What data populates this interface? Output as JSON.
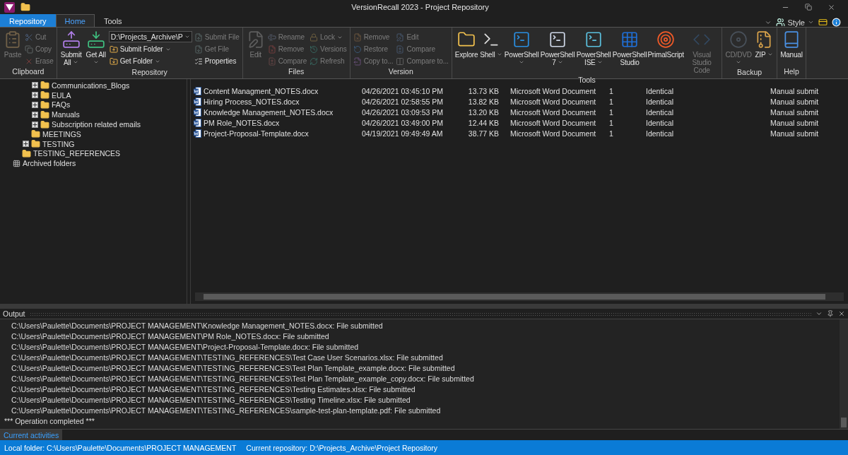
{
  "window": {
    "title": "VersionRecall 2023 - Project Repository"
  },
  "ribbon_tabs": [
    {
      "label": "Repository",
      "kind": "file",
      "selected": false
    },
    {
      "label": "Home",
      "kind": "tab",
      "selected": true
    },
    {
      "label": "Tools",
      "kind": "tab",
      "selected": false
    }
  ],
  "style_menu": {
    "label": "Style"
  },
  "ribbon_groups": [
    {
      "label": "Clipboard",
      "buttons": [
        {
          "kind": "large",
          "label": "Paste",
          "disabled": true,
          "dropdown": false
        },
        {
          "kind": "small",
          "label": "Cut",
          "disabled": true,
          "dropdown": false
        },
        {
          "kind": "small",
          "label": "Copy",
          "disabled": true,
          "dropdown": false
        },
        {
          "kind": "small",
          "label": "Erase",
          "disabled": true,
          "dropdown": false
        }
      ]
    },
    {
      "label": "Repository",
      "buttons": [
        {
          "kind": "large",
          "label": "Submit All",
          "disabled": false,
          "dropdown": true
        },
        {
          "kind": "large",
          "label": "Get All",
          "disabled": false,
          "dropdown": true
        },
        {
          "kind": "combo",
          "label": "D:\\Projects_Archive\\P",
          "disabled": false,
          "dropdown": true
        },
        {
          "kind": "small",
          "label": "Submit Folder",
          "disabled": false,
          "dropdown": true
        },
        {
          "kind": "small",
          "label": "Get Folder",
          "disabled": false,
          "dropdown": true
        },
        {
          "kind": "small",
          "label": "Submit File",
          "disabled": true,
          "dropdown": false
        },
        {
          "kind": "small",
          "label": "Get File",
          "disabled": true,
          "dropdown": false
        },
        {
          "kind": "small",
          "label": "Properties",
          "disabled": false,
          "dropdown": false
        }
      ]
    },
    {
      "label": "Files",
      "buttons": [
        {
          "kind": "large",
          "label": "Edit",
          "disabled": true,
          "dropdown": false
        },
        {
          "kind": "small",
          "label": "Rename",
          "disabled": true,
          "dropdown": false
        },
        {
          "kind": "small",
          "label": "Remove",
          "disabled": true,
          "dropdown": false
        },
        {
          "kind": "small",
          "label": "Compare",
          "disabled": true,
          "dropdown": false
        },
        {
          "kind": "small",
          "label": "Lock",
          "disabled": true,
          "dropdown": true
        },
        {
          "kind": "small",
          "label": "Versions",
          "disabled": true,
          "dropdown": false
        },
        {
          "kind": "small",
          "label": "Refresh",
          "disabled": true,
          "dropdown": false
        }
      ]
    },
    {
      "label": "Version",
      "buttons": [
        {
          "kind": "small",
          "label": "Remove",
          "disabled": true,
          "dropdown": false
        },
        {
          "kind": "small",
          "label": "Restore",
          "disabled": true,
          "dropdown": false
        },
        {
          "kind": "small",
          "label": "Copy to...",
          "disabled": true,
          "dropdown": false
        },
        {
          "kind": "small",
          "label": "Edit",
          "disabled": true,
          "dropdown": false
        },
        {
          "kind": "small",
          "label": "Compare",
          "disabled": true,
          "dropdown": false
        },
        {
          "kind": "small",
          "label": "Compare to...",
          "disabled": true,
          "dropdown": false
        }
      ]
    },
    {
      "label": "Tools",
      "buttons": [
        {
          "kind": "large",
          "label": "Explore",
          "disabled": false,
          "dropdown": false
        },
        {
          "kind": "large",
          "label": "Shell",
          "disabled": false,
          "dropdown": true
        },
        {
          "kind": "large",
          "label": "PowerShell",
          "disabled": false,
          "dropdown": true
        },
        {
          "kind": "large",
          "label": "PowerShell 7",
          "disabled": false,
          "dropdown": true
        },
        {
          "kind": "large",
          "label": "PowerShell ISE",
          "disabled": false,
          "dropdown": true
        },
        {
          "kind": "large",
          "label": "PowerShell Studio",
          "disabled": false,
          "dropdown": false
        },
        {
          "kind": "large",
          "label": "PrimalScript",
          "disabled": false,
          "dropdown": false
        },
        {
          "kind": "large",
          "label": "Visual Studio Code",
          "disabled": true,
          "dropdown": false
        }
      ]
    },
    {
      "label": "Backup",
      "buttons": [
        {
          "kind": "large",
          "label": "CD/DVD",
          "disabled": true,
          "dropdown": true
        },
        {
          "kind": "large",
          "label": "ZIP",
          "disabled": false,
          "dropdown": true
        }
      ]
    },
    {
      "label": "Help",
      "buttons": [
        {
          "kind": "large",
          "label": "Manual",
          "disabled": false,
          "dropdown": false
        }
      ]
    }
  ],
  "tree": [
    {
      "children": [
        {
          "children": [
            {
              "children": [
                {
                  "label": "Communications_Blogs",
                  "collapsed": true
                },
                {
                  "label": "EULA",
                  "collapsed": true
                },
                {
                  "label": "FAQs",
                  "collapsed": true
                },
                {
                  "label": "Manuals",
                  "collapsed": true
                },
                {
                  "label": "Subscription related emails",
                  "collapsed": true
                }
              ]
            },
            {
              "label": "MEETINGS",
              "collapsed": false
            },
            {
              "label": "TESTING",
              "collapsed": true
            }
          ]
        },
        {
          "label": "TESTING_REFERENCES",
          "collapsed": false
        }
      ]
    },
    {
      "label": "Archived folders",
      "kind": "archive",
      "collapsed": false
    }
  ],
  "files": [
    {
      "name": "Content Managment_NOTES.docx",
      "column_2": "04/26/2021 03:45:10 PM",
      "column_3": "13.73 KB",
      "column_4": "Microsoft Word Document",
      "column_5": "1",
      "column_6": "Identical",
      "column_7": "Manual submit"
    },
    {
      "name": "Hiring Process_NOTES.docx",
      "column_2": "04/26/2021 02:58:55 PM",
      "column_3": "13.82 KB",
      "column_4": "Microsoft Word Document",
      "column_5": "1",
      "column_6": "Identical",
      "column_7": "Manual submit"
    },
    {
      "name": "Knowledge Management_NOTES.docx",
      "column_2": "04/26/2021 03:09:53 PM",
      "column_3": "13.20 KB",
      "column_4": "Microsoft Word Document",
      "column_5": "1",
      "column_6": "Identical",
      "column_7": "Manual submit"
    },
    {
      "name": "PM Role_NOTES.docx",
      "column_2": "04/26/2021 03:49:00 PM",
      "column_3": "12.44 KB",
      "column_4": "Microsoft Word Document",
      "column_5": "1",
      "column_6": "Identical",
      "column_7": "Manual submit"
    },
    {
      "name": "Project-Proposal-Template.docx",
      "column_2": "04/19/2021 09:49:49 AM",
      "column_3": "38.77 KB",
      "column_4": "Microsoft Word Document",
      "column_5": "1",
      "column_6": "Identical",
      "column_7": "Manual submit"
    }
  ],
  "output": {
    "title": "Output",
    "lines": [
      "C:\\Users\\Paulette\\Documents\\PROJECT MANAGEMENT\\Knowledge Management_NOTES.docx: File submitted",
      "C:\\Users\\Paulette\\Documents\\PROJECT MANAGEMENT\\PM Role_NOTES.docx: File submitted",
      "C:\\Users\\Paulette\\Documents\\PROJECT MANAGEMENT\\Project-Proposal-Template.docx: File submitted",
      "C:\\Users\\Paulette\\Documents\\PROJECT MANAGEMENT\\TESTING_REFERENCES\\Test Case User Scenarios.xlsx: File submitted",
      "C:\\Users\\Paulette\\Documents\\PROJECT MANAGEMENT\\TESTING_REFERENCES\\Test Plan Template_example.docx: File submitted",
      "C:\\Users\\Paulette\\Documents\\PROJECT MANAGEMENT\\TESTING_REFERENCES\\Test Plan Template_example_copy.docx: File submitted",
      "C:\\Users\\Paulette\\Documents\\PROJECT MANAGEMENT\\TESTING_REFERENCES\\Testing Estimates.xlsx: File submitted",
      "C:\\Users\\Paulette\\Documents\\PROJECT MANAGEMENT\\TESTING_REFERENCES\\Testing Timeline.xlsx: File submitted",
      "C:\\Users\\Paulette\\Documents\\PROJECT MANAGEMENT\\TESTING_REFERENCES\\sample-test-plan-template.pdf: File submitted"
    ],
    "summary": "*** Operation completed ***"
  },
  "bottom_tabs": [
    {
      "label": "Current activities",
      "selected": true
    }
  ],
  "status_bar": [
    "Local folder: C:\\Users\\Paulette\\Documents\\PROJECT MANAGEMENT",
    "Current repository: D:\\Projects_Archive\\Project Repository"
  ]
}
